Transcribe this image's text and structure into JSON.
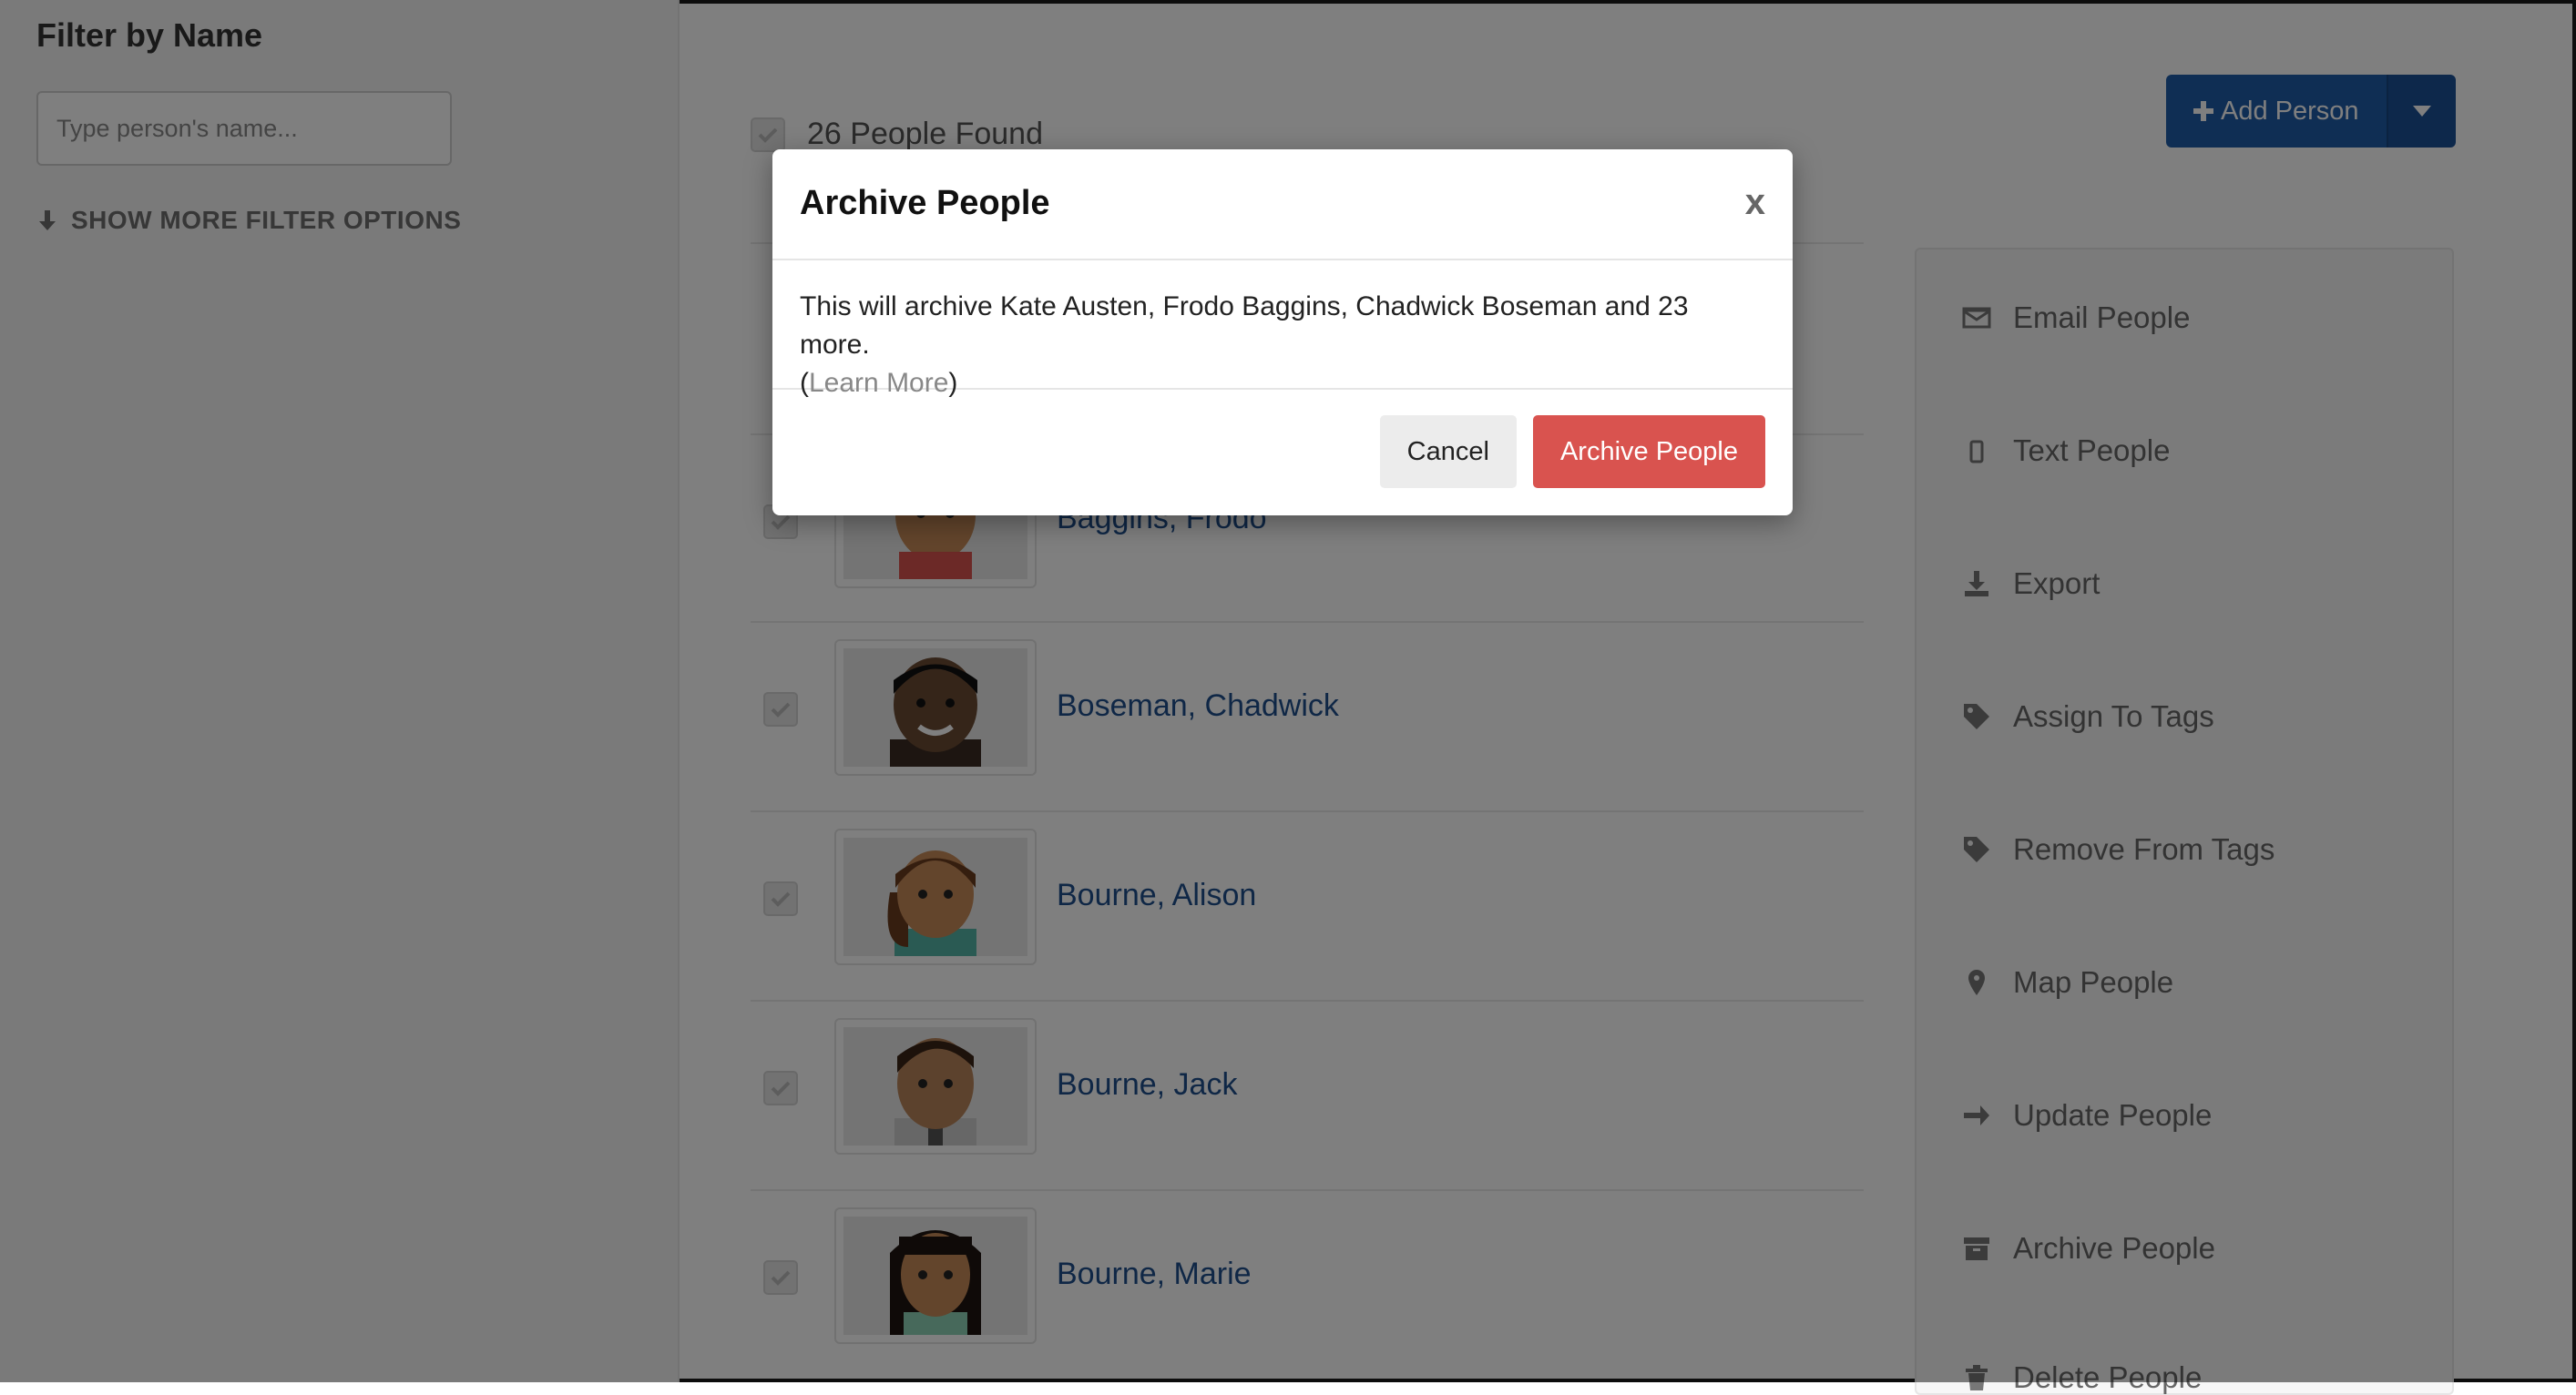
{
  "filter": {
    "title": "Filter by Name",
    "search_placeholder": "Type person's name...",
    "show_more_label": "SHOW MORE FILTER OPTIONS"
  },
  "list": {
    "found_label": "26 People Found",
    "people": [
      {
        "name": "Baggins, Frodo",
        "avatar": "male-light-avatar"
      },
      {
        "name": "Boseman, Chadwick",
        "avatar": "male-dark-avatar"
      },
      {
        "name": "Bourne, Alison",
        "avatar": "female-ponytail-avatar"
      },
      {
        "name": "Bourne, Jack",
        "avatar": "male-avatar"
      },
      {
        "name": "Bourne, Marie",
        "avatar": "female-longhair-avatar"
      }
    ]
  },
  "toolbar": {
    "add_person_label": "Add Person"
  },
  "actions": [
    {
      "label": "Email People",
      "icon": "envelope-icon"
    },
    {
      "label": "Text People",
      "icon": "mobile-icon"
    },
    {
      "label": "Export",
      "icon": "download-icon"
    },
    {
      "label": "Assign To Tags",
      "icon": "tag-icon"
    },
    {
      "label": "Remove From Tags",
      "icon": "tag-icon"
    },
    {
      "label": "Map People",
      "icon": "map-marker-icon"
    },
    {
      "label": "Update People",
      "icon": "arrow-right-icon"
    },
    {
      "label": "Archive People",
      "icon": "archive-box-icon"
    },
    {
      "label": "Delete People",
      "icon": "trash-icon"
    }
  ],
  "modal": {
    "title": "Archive People",
    "close_label": "x",
    "message": "This will archive Kate Austen, Frodo Baggins, Chadwick Boseman and 23 more.",
    "learn_more_open": "(",
    "learn_more_label": "Learn More",
    "learn_more_close": ")",
    "cancel_label": "Cancel",
    "confirm_label": "Archive People"
  },
  "colors": {
    "primary": "#1e5da8",
    "danger": "#d9534f",
    "link": "#1f4e8c"
  }
}
